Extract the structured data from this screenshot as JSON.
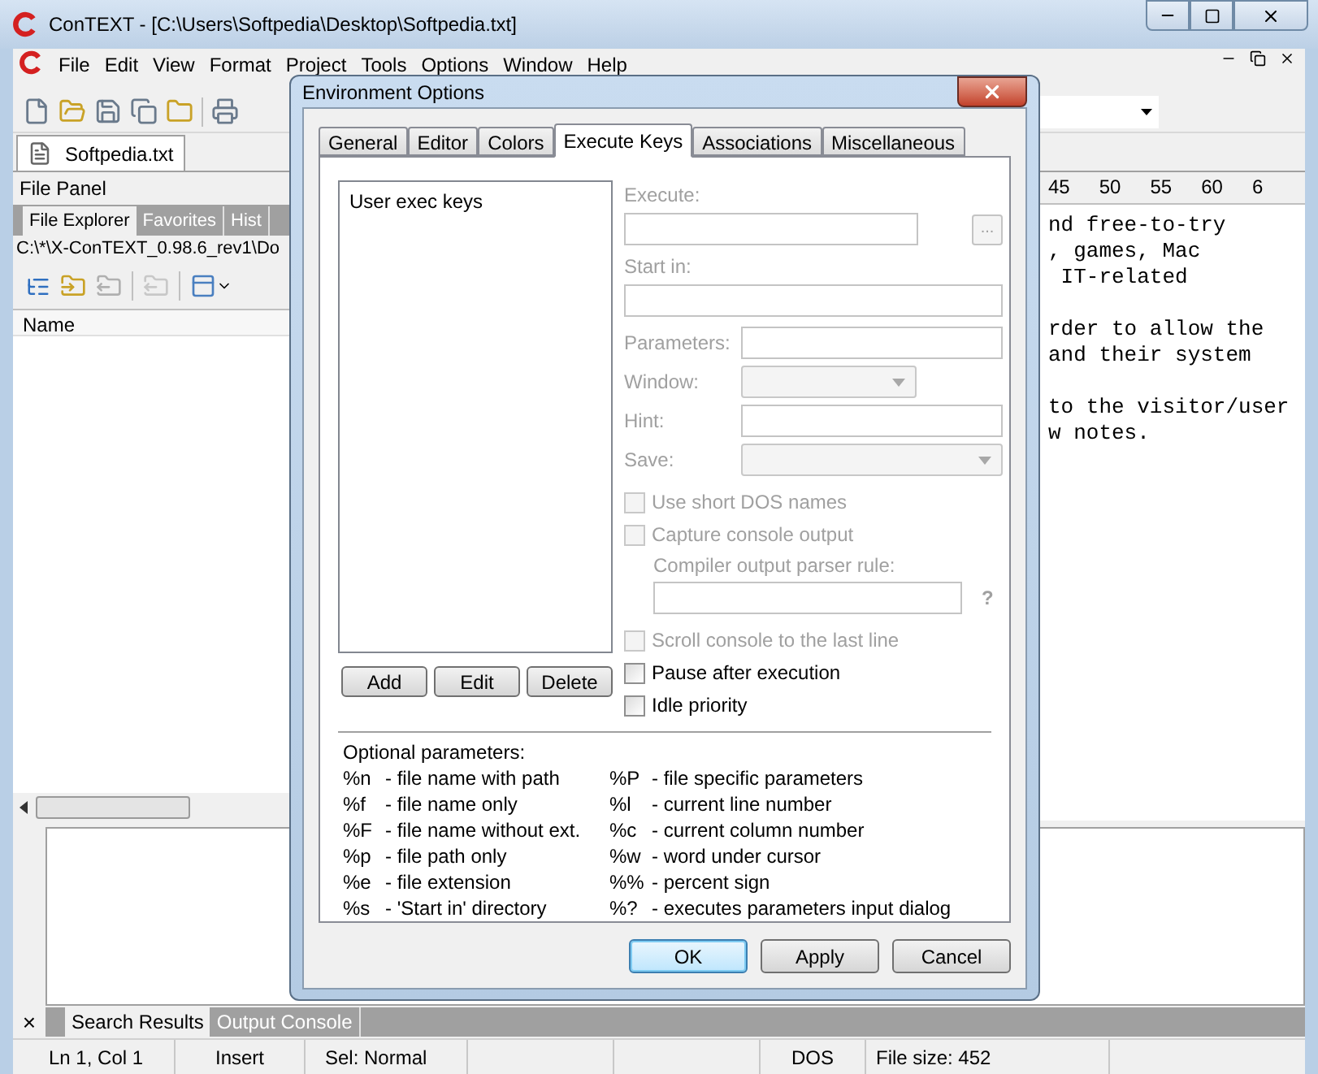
{
  "window": {
    "title": "ConTEXT - [C:\\Users\\Softpedia\\Desktop\\Softpedia.txt]"
  },
  "menu": [
    "File",
    "Edit",
    "View",
    "Format",
    "Project",
    "Tools",
    "Options",
    "Window",
    "Help"
  ],
  "document_tabs": [
    {
      "label": "Softpedia.txt",
      "selected": true
    }
  ],
  "file_panel": {
    "title": "File Panel",
    "tabs": [
      {
        "label": "File Explorer",
        "selected": true
      },
      {
        "label": "Favorites",
        "selected": false
      },
      {
        "label": "Hist",
        "selected": false
      }
    ],
    "path": "C:\\*\\X-ConTEXT_0.98.6_rev1\\Do",
    "columns": [
      "Name"
    ]
  },
  "editor": {
    "ruler": [
      "45",
      "50",
      "55",
      "60",
      "6"
    ],
    "paragraphs": [
      [
        "nd free-to-try",
        ", games, Mac",
        " IT-related"
      ],
      [
        "rder to allow the",
        "and their system"
      ],
      [
        "to the visitor/user",
        "w notes."
      ]
    ]
  },
  "bottom_tabs": [
    {
      "label": "Search Results",
      "selected": true
    },
    {
      "label": "Output Console",
      "selected": false
    }
  ],
  "bottom_close": "×",
  "status_bar": [
    "Ln 1, Col 1",
    "Insert",
    "Sel: Normal",
    "DOS",
    "File size: 452"
  ],
  "dialog": {
    "title": "Environment Options",
    "tabs": [
      {
        "label": "General",
        "selected": false
      },
      {
        "label": "Editor",
        "selected": false
      },
      {
        "label": "Colors",
        "selected": false
      },
      {
        "label": "Execute Keys",
        "selected": true
      },
      {
        "label": "Associations",
        "selected": false
      },
      {
        "label": "Miscellaneous",
        "selected": false
      }
    ],
    "list_items": [
      {
        "label": "User exec keys",
        "selected": false
      }
    ],
    "list_buttons": [
      "Add",
      "Edit",
      "Delete"
    ],
    "fields": [
      {
        "label": "Execute:",
        "kind": "stacked",
        "disabled": true,
        "browse": "..."
      },
      {
        "label": "Start in:",
        "kind": "stacked",
        "disabled": true
      },
      {
        "label": "Parameters:",
        "kind": "inline_input",
        "disabled": true
      },
      {
        "label": "Window:",
        "kind": "inline_select",
        "disabled": true
      },
      {
        "label": "Hint:",
        "kind": "inline_input",
        "disabled": true
      },
      {
        "label": "Save:",
        "kind": "inline_select_wide",
        "disabled": true
      }
    ],
    "options": [
      {
        "kind": "checkbox",
        "label": "Use short DOS names",
        "checked": false,
        "disabled": true
      },
      {
        "kind": "checkbox",
        "label": "Capture console output",
        "checked": false,
        "disabled": true
      },
      {
        "kind": "parser_rule",
        "label": "Compiler output parser rule:",
        "help": "?",
        "disabled": true
      },
      {
        "kind": "checkbox",
        "label": "Scroll console to the last line",
        "checked": false,
        "disabled": true
      },
      {
        "kind": "checkbox",
        "label": "Pause after execution",
        "checked": false,
        "disabled": false
      },
      {
        "kind": "checkbox",
        "label": "Idle priority",
        "checked": false,
        "disabled": false
      }
    ],
    "parameters_title": "Optional parameters:",
    "parameters": [
      [
        {
          "code": "%n",
          "description": "- file name with path"
        },
        {
          "code": "%f",
          "description": "- file name only"
        },
        {
          "code": "%F",
          "description": "- file name without ext."
        },
        {
          "code": "%p",
          "description": "- file path only"
        },
        {
          "code": "%e",
          "description": "- file extension"
        },
        {
          "code": "%s",
          "description": "- 'Start in' directory"
        }
      ],
      [
        {
          "code": "%P",
          "description": "- file specific parameters"
        },
        {
          "code": "%l",
          "description": "- current line number"
        },
        {
          "code": "%c",
          "description": "- current column number"
        },
        {
          "code": "%w",
          "description": "- word under cursor"
        },
        {
          "code": "%%",
          "description": "- percent sign"
        },
        {
          "code": "%?",
          "description": "- executes parameters input dialog"
        }
      ]
    ],
    "buttons": [
      {
        "label": "OK",
        "default": true
      },
      {
        "label": "Apply",
        "default": false
      },
      {
        "label": "Cancel",
        "default": false
      }
    ]
  }
}
